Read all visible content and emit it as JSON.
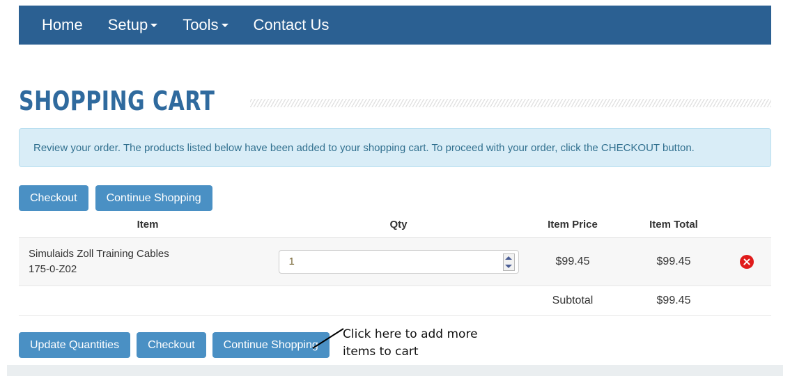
{
  "navbar": {
    "items": [
      {
        "label": "Home",
        "has_caret": false
      },
      {
        "label": "Setup",
        "has_caret": true
      },
      {
        "label": "Tools",
        "has_caret": true
      },
      {
        "label": "Contact Us",
        "has_caret": false
      }
    ]
  },
  "page": {
    "title": "SHOPPING CART",
    "info_banner": "Review your order. The products listed below have been added to your shopping cart. To proceed with your order, click the CHECKOUT button."
  },
  "top_buttons": {
    "checkout": "Checkout",
    "continue_shopping": "Continue Shopping"
  },
  "table": {
    "headers": {
      "item": "Item",
      "qty": "Qty",
      "item_price": "Item Price",
      "item_total": "Item Total"
    },
    "rows": [
      {
        "name": "Simulaids Zoll Training Cables",
        "sku": "175-0-Z02",
        "qty": "1",
        "item_price": "$99.45",
        "item_total": "$99.45",
        "delete_icon": "delete-circle-x-icon"
      }
    ],
    "subtotal_label": "Subtotal",
    "subtotal_value": "$99.45"
  },
  "bottom_buttons": {
    "update_quantities": "Update Quantities",
    "checkout": "Checkout",
    "continue_shopping": "Continue Shopping"
  },
  "annotation": {
    "line1": "Click here to add more",
    "line2": "items to cart"
  },
  "colors": {
    "navbar": "#2b6092",
    "button": "#4a90c4",
    "title": "#2f6a9e",
    "banner_bg": "#d9edf7",
    "banner_text": "#31708f",
    "delete": "#e01b1b",
    "row_bg": "#f7f7f7"
  }
}
